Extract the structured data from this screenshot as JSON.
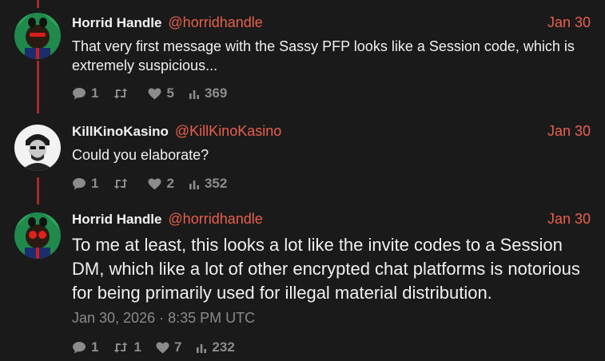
{
  "posts": [
    {
      "author": "Horrid Handle",
      "handle": "@horridhandle",
      "date": "Jan 30",
      "text": "That very first message with the Sassy PFP looks like a Session code, which is extremely suspicious...",
      "replies": "1",
      "reposts": "",
      "likes": "5",
      "views": "369"
    },
    {
      "author": "KillKinoKasino",
      "handle": "@KillKinoKasino",
      "date": "Jan 30",
      "text": "Could you elaborate?",
      "replies": "1",
      "reposts": "",
      "likes": "2",
      "views": "352"
    },
    {
      "author": "Horrid Handle",
      "handle": "@horridhandle",
      "date": "Jan 30",
      "text": "To me at least, this looks a lot like the invite codes to a Session DM, which like a lot of other encrypted chat platforms is notorious for being primarily used for illegal material distribution.",
      "timestamp": "Jan 30, 2026 · 8:35 PM UTC",
      "replies": "1",
      "reposts": "1",
      "likes": "7",
      "views": "232"
    }
  ],
  "colors": {
    "background": "#1a1a1a",
    "accent": "#e8604c",
    "thread_line": "#a52a2a",
    "muted": "#8c8c8c"
  },
  "icons": {
    "reply": "speech-bubble-icon",
    "repost": "retweet-icon",
    "like": "heart-icon",
    "views": "bar-chart-icon"
  }
}
